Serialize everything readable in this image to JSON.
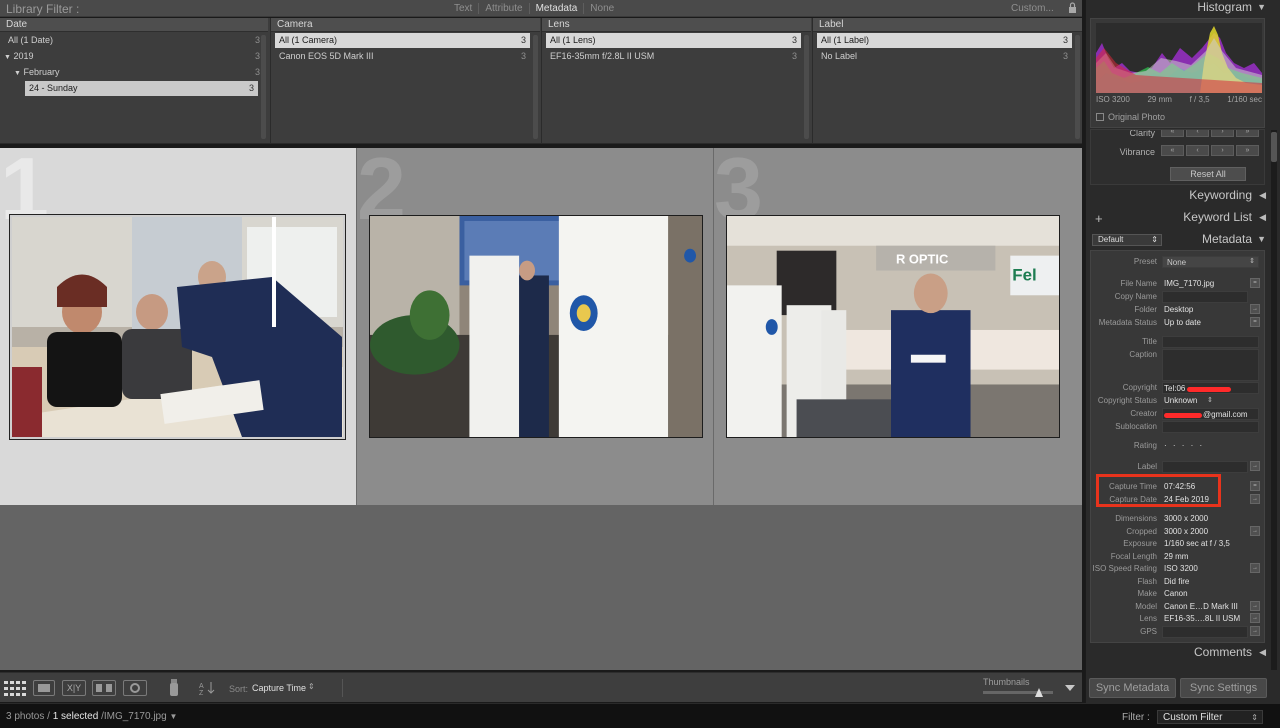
{
  "filter_bar": {
    "title": "Library Filter :",
    "modes": [
      "Text",
      "Attribute",
      "Metadata",
      "None"
    ],
    "active_mode": "Metadata",
    "preset": "Custom..."
  },
  "filter_columns": {
    "date": {
      "header": "Date",
      "rows": [
        {
          "label": "All (1 Date)",
          "count": "3"
        },
        {
          "label": "2019",
          "count": "3"
        },
        {
          "label": "February",
          "count": "3"
        },
        {
          "label": "24 - Sunday",
          "count": "3"
        }
      ]
    },
    "camera": {
      "header": "Camera",
      "rows": [
        {
          "label": "All (1 Camera)",
          "count": "3"
        },
        {
          "label": "Canon EOS 5D Mark III",
          "count": "3"
        }
      ]
    },
    "lens": {
      "header": "Lens",
      "rows": [
        {
          "label": "All (1 Lens)",
          "count": "3"
        },
        {
          "label": "EF16-35mm f/2.8L II USM",
          "count": "3"
        }
      ]
    },
    "label": {
      "header": "Label",
      "rows": [
        {
          "label": "All (1 Label)",
          "count": "3"
        },
        {
          "label": "No Label",
          "count": "3"
        }
      ]
    }
  },
  "grid": {
    "cells": [
      {
        "index": "1",
        "selected": true
      },
      {
        "index": "2",
        "selected": false
      },
      {
        "index": "3",
        "selected": false
      }
    ]
  },
  "toolbar": {
    "sort_label": "Sort:",
    "sort_value": "Capture Time",
    "thumbnails_label": "Thumbnails",
    "thumbnail_size": 0.8
  },
  "statusbar": {
    "count": "3 photos /",
    "selected": "1 selected",
    "filename": "/IMG_7170.jpg",
    "filter_label": "Filter :",
    "filter_value": "Custom Filter"
  },
  "histogram": {
    "title": "Histogram",
    "iso": "ISO 3200",
    "focal": "29 mm",
    "aperture": "f / 3,5",
    "shutter": "1/160 sec",
    "original_photo": "Original Photo"
  },
  "quick_develop": {
    "clarity": "Clarity",
    "vibrance": "Vibrance",
    "reset_all": "Reset All"
  },
  "panels": {
    "keywording": "Keywording",
    "keyword_list": "Keyword List",
    "metadata": "Metadata",
    "comments": "Comments",
    "metadata_preset_select": "Default"
  },
  "metadata": {
    "preset_label": "Preset",
    "preset_value": "None",
    "file_name": "IMG_7170.jpg",
    "copy_name": "",
    "folder": "Desktop",
    "metadata_status": "Up to date",
    "title": "",
    "caption": "",
    "copyright": "Tel:06",
    "copyright_status": "Unknown",
    "creator": "@gmail.com",
    "sublocation": "",
    "rating": "· · · · ·",
    "label": "",
    "capture_time": "07:42:56",
    "capture_date": "24 Feb 2019",
    "dimensions": "3000 x 2000",
    "cropped": "3000 x 2000",
    "exposure": "1/160 sec at f / 3,5",
    "focal_length": "29 mm",
    "iso_speed": "ISO 3200",
    "flash": "Did fire",
    "make": "Canon",
    "model": "Canon E…D Mark III",
    "lens": "EF16-35….8L II USM",
    "gps": ""
  },
  "sync": {
    "sync_metadata": "Sync Metadata",
    "sync_settings": "Sync Settings"
  },
  "colors": {
    "highlight": "#e8331c",
    "redaction": "#ff2a2a"
  }
}
